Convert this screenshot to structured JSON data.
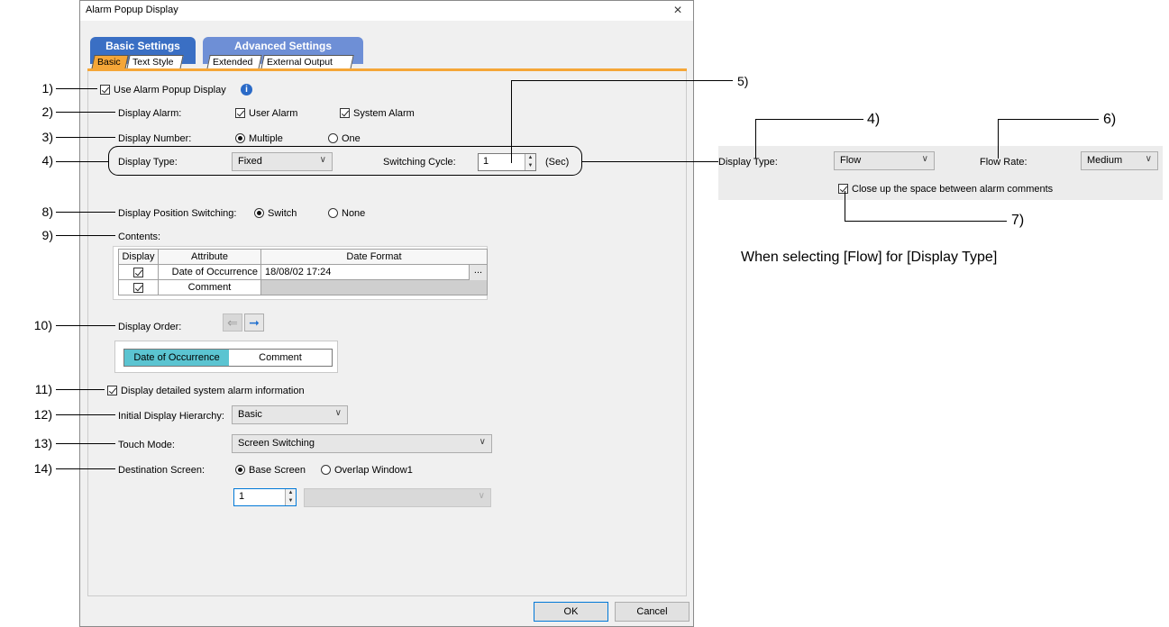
{
  "dialog": {
    "title": "Alarm Popup Display",
    "close_glyph": "×",
    "group_tabs": [
      "Basic Settings",
      "Advanced Settings"
    ],
    "sub_tabs": [
      "Basic",
      "Text Style",
      "Extended",
      "External Output"
    ],
    "colors": {
      "basic_tab": "#3a6fc4",
      "advanced_tab": "#6e8fd6",
      "active_strip": "#f5a638",
      "order_highlight": "#5bc4d1"
    }
  },
  "form": {
    "use_popup": {
      "label": "Use Alarm Popup Display",
      "checked": true,
      "info_icon": "i"
    },
    "display_alarm": {
      "label": "Display Alarm:",
      "user": "User Alarm",
      "system": "System Alarm"
    },
    "display_number": {
      "label": "Display Number:",
      "multiple": "Multiple",
      "one": "One",
      "selected": "Multiple"
    },
    "display_type": {
      "label": "Display Type:",
      "value": "Fixed"
    },
    "switching_cycle": {
      "label": "Switching Cycle:",
      "value": "1",
      "unit": "(Sec)"
    },
    "position_switching": {
      "label": "Display Position Switching:",
      "switch": "Switch",
      "none": "None",
      "selected": "Switch"
    },
    "contents": {
      "label": "Contents:",
      "headers": [
        "Display",
        "Attribute",
        "Date Format"
      ],
      "rows": [
        {
          "display": true,
          "attribute": "Date of Occurrence",
          "format": "18/08/02 17:24"
        },
        {
          "display": true,
          "attribute": "Comment",
          "format": ""
        }
      ],
      "browse": "..."
    },
    "display_order": {
      "label": "Display Order:",
      "items": [
        "Date of Occurrence",
        "Comment"
      ]
    },
    "detailed_info": {
      "label": "Display detailed system alarm information",
      "checked": true
    },
    "initial_hierarchy": {
      "label": "Initial Display Hierarchy:",
      "value": "Basic"
    },
    "touch_mode": {
      "label": "Touch Mode:",
      "value": "Screen Switching"
    },
    "destination": {
      "label": "Destination Screen:",
      "base": "Base Screen",
      "overlap": "Overlap Window1",
      "selected": "Base Screen",
      "number": "1"
    },
    "ok": "OK",
    "cancel": "Cancel"
  },
  "callouts": [
    "1)",
    "2)",
    "3)",
    "4)",
    "5)",
    "8)",
    "9)",
    "10)",
    "11)",
    "12)",
    "13)",
    "14)"
  ],
  "flow_panel": {
    "display_type_label": "Display Type:",
    "display_type_value": "Flow",
    "flow_rate_label": "Flow Rate:",
    "flow_rate_value": "Medium",
    "close_up_label": "Close up the space between alarm comments",
    "callouts": [
      "4)",
      "6)",
      "7)"
    ],
    "caption": "When selecting [Flow] for [Display Type]"
  }
}
